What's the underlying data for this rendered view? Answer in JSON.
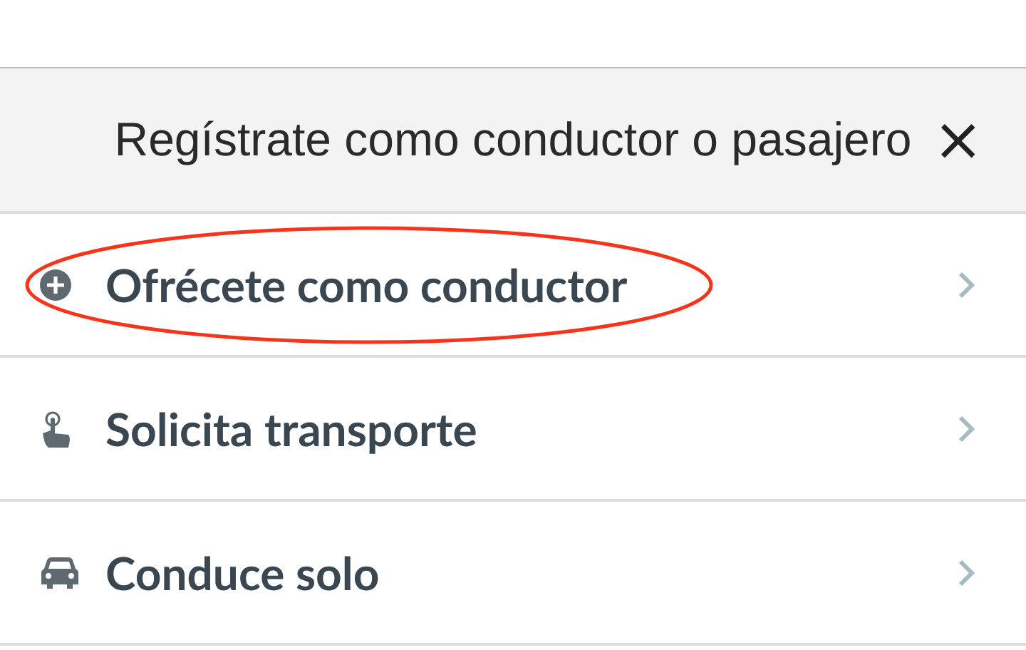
{
  "dialog": {
    "title": "Regístrate como conductor o pasajero",
    "close": "×"
  },
  "options": [
    {
      "kind": "plus",
      "label": "Ofrécete como conductor",
      "circled": true
    },
    {
      "kind": "touch",
      "label": "Solicita transporte",
      "circled": false
    },
    {
      "kind": "car",
      "label": "Conduce solo",
      "circled": false
    }
  ]
}
